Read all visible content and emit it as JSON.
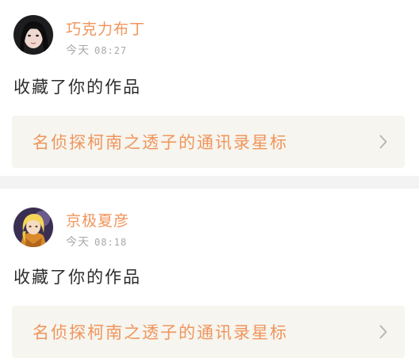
{
  "feed": [
    {
      "username": "巧克力布丁",
      "day": "今天",
      "time": "08:27",
      "action": "收藏了你的作品",
      "work_title": "名侦探柯南之透子的通讯录星标"
    },
    {
      "username": "京极夏彦",
      "day": "今天",
      "time": "08:18",
      "action": "收藏了你的作品",
      "work_title": "名侦探柯南之透子的通讯录星标"
    }
  ],
  "colors": {
    "accent": "#f0955c",
    "text": "#2b2b2b",
    "muted": "#a8a8a8",
    "work_bg": "#f6f5ef",
    "page_bg": "#f3f3f3"
  },
  "icons": [
    "chevron-right-icon"
  ]
}
